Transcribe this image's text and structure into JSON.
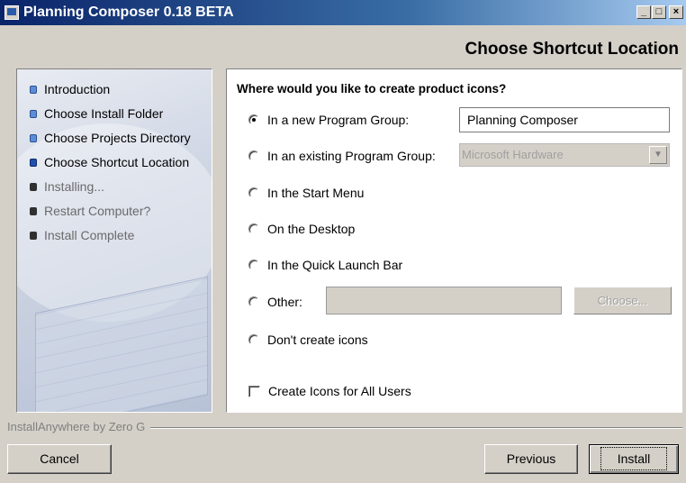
{
  "window": {
    "title": "Planning Composer 0.18 BETA",
    "controls": {
      "minimize": "_",
      "maximize": "□",
      "close": "×"
    }
  },
  "header": {
    "title": "Choose Shortcut Location"
  },
  "sidebar": {
    "steps": [
      {
        "label": "Introduction",
        "state": "done"
      },
      {
        "label": "Choose Install Folder",
        "state": "done"
      },
      {
        "label": "Choose Projects Directory",
        "state": "done"
      },
      {
        "label": "Choose Shortcut Location",
        "state": "current"
      },
      {
        "label": "Installing...",
        "state": "pending"
      },
      {
        "label": "Restart Computer?",
        "state": "pending"
      },
      {
        "label": "Install Complete",
        "state": "pending"
      }
    ]
  },
  "main": {
    "question": "Where would you like to create product icons?",
    "options": {
      "new_group": "In a new Program Group:",
      "existing_group": "In an existing Program Group:",
      "start_menu": "In the Start Menu",
      "desktop": "On the Desktop",
      "quick_launch": "In the Quick Launch Bar",
      "other": "Other:",
      "none": "Don't create icons"
    },
    "selected_option": "new_group",
    "new_group_value": "Planning Composer",
    "existing_group_value": "Microsoft Hardware",
    "other_value": "",
    "choose_label": "Choose...",
    "all_users_label": "Create Icons for All Users",
    "all_users_checked": false
  },
  "footer": {
    "brand": "InstallAnywhere by Zero G",
    "cancel_label": "Cancel",
    "previous_label": "Previous",
    "install_label": "Install"
  },
  "colors": {
    "titlebar_start": "#0a246a",
    "titlebar_end": "#a6caf0",
    "dialog_face": "#d4d0c8",
    "current_step_bullet": "#1e50b0"
  }
}
